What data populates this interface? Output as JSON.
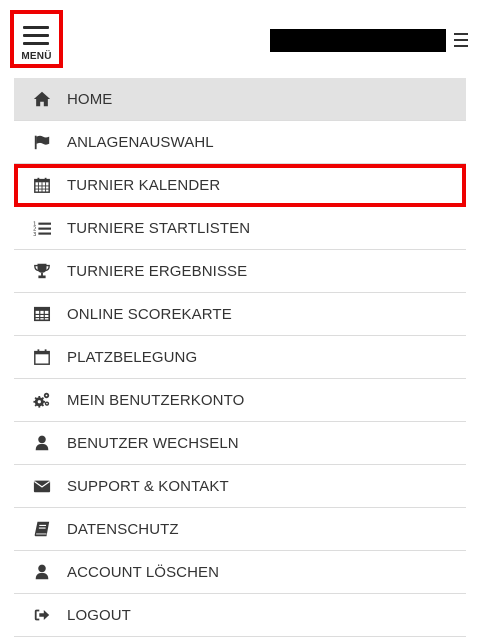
{
  "header": {
    "menu_label": "MENÜ"
  },
  "nav": {
    "items": [
      {
        "label": "HOME",
        "icon": "home-icon"
      },
      {
        "label": "ANLAGENAUSWAHL",
        "icon": "flag-icon"
      },
      {
        "label": "TURNIER KALENDER",
        "icon": "calendar-icon"
      },
      {
        "label": "TURNIERE STARTLISTEN",
        "icon": "ordered-list-icon"
      },
      {
        "label": "TURNIERE ERGEBNISSE",
        "icon": "trophy-icon"
      },
      {
        "label": "ONLINE SCOREKARTE",
        "icon": "table-icon"
      },
      {
        "label": "PLATZBELEGUNG",
        "icon": "calendar-outline-icon"
      },
      {
        "label": "MEIN BENUTZERKONTO",
        "icon": "gears-icon"
      },
      {
        "label": "BENUTZER WECHSELN",
        "icon": "user-icon"
      },
      {
        "label": "SUPPORT & KONTAKT",
        "icon": "envelope-icon"
      },
      {
        "label": "DATENSCHUTZ",
        "icon": "book-icon"
      },
      {
        "label": "ACCOUNT LÖSCHEN",
        "icon": "user-icon"
      },
      {
        "label": "LOGOUT",
        "icon": "sign-out-icon"
      }
    ]
  }
}
